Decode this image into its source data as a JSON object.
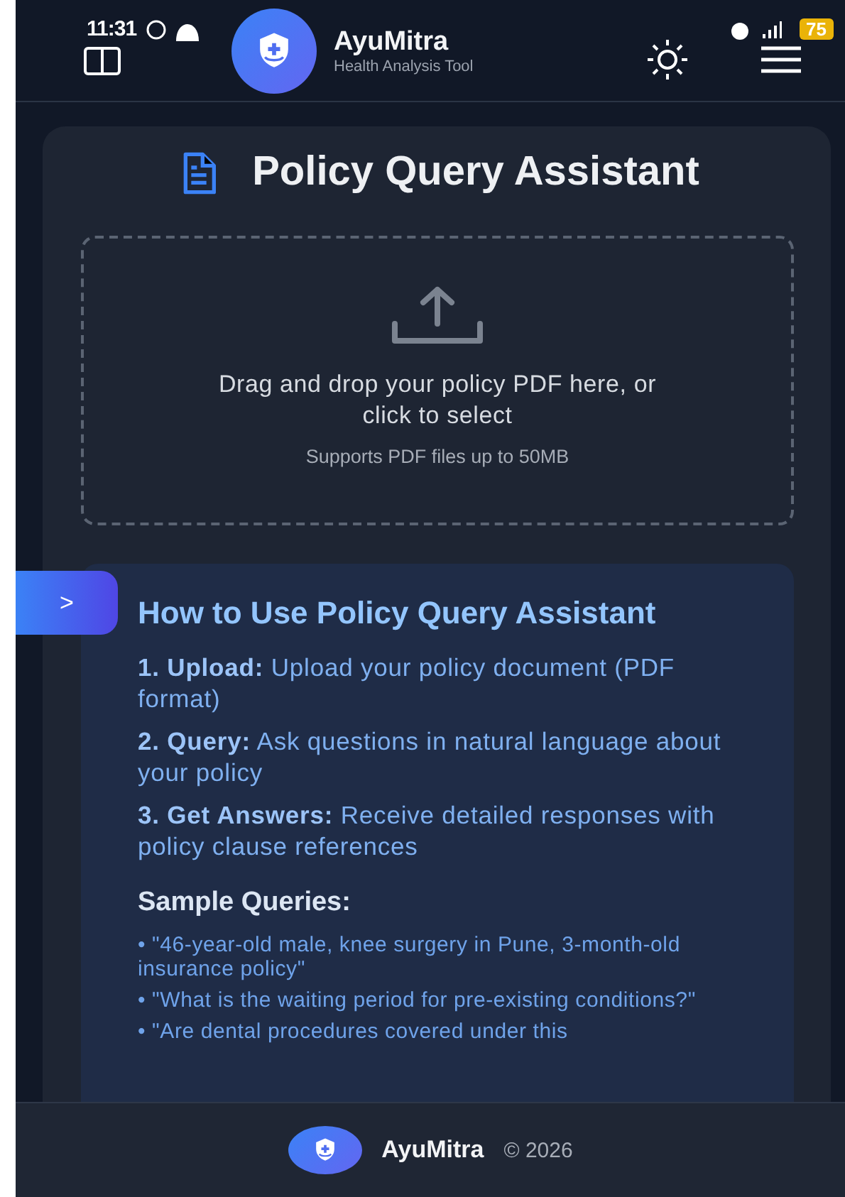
{
  "status_bar": {
    "time": "11:31",
    "battery": "75"
  },
  "header": {
    "title": "AyuMitra",
    "subtitle": "Health Analysis Tool"
  },
  "page": {
    "title": "Policy Query Assistant"
  },
  "dropzone": {
    "prompt": "Drag and drop your policy PDF here, or click to select",
    "note": "Supports PDF files up to 50MB"
  },
  "side_tab": {
    "label": ">"
  },
  "help": {
    "title": "How to Use Policy Query Assistant",
    "steps": [
      "**1. Upload:** Upload your policy document (PDF format)",
      "**2. Query:** Ask questions in natural language about your policy",
      "**3. Get Answers:** Receive detailed responses with policy clause references"
    ],
    "samples_title": "Sample Queries:",
    "samples": [
      "• \"46-year-old male, knee surgery in Pune, 3-month-old insurance policy\"",
      "• \"What is the waiting period for pre-existing conditions?\"",
      "• \"Are dental procedures covered under this"
    ]
  },
  "footer": {
    "brand": "AyuMitra",
    "copyright": "© 2026"
  }
}
